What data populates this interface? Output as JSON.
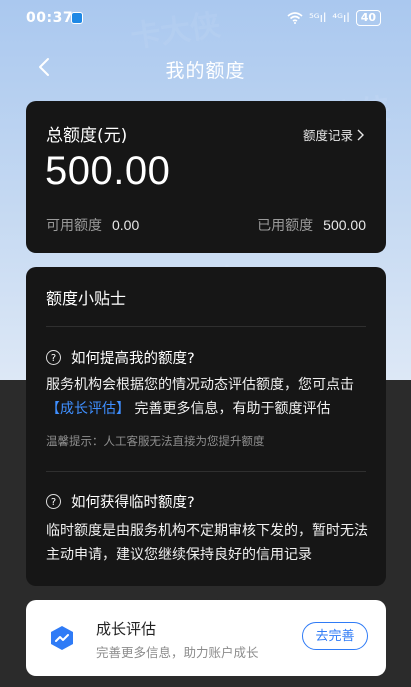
{
  "status_bar": {
    "time": "00:37",
    "signal_1": "⁵ᴳıl",
    "signal_2": "⁴ᴳıl",
    "battery": "40"
  },
  "header": {
    "title": "我的额度"
  },
  "total_card": {
    "label": "总额度(元)",
    "record_link": "额度记录",
    "amount": "500.00",
    "available_label": "可用额度",
    "available_value": "0.00",
    "used_label": "已用额度",
    "used_value": "500.00"
  },
  "tips": {
    "title": "额度小贴士",
    "q1": {
      "question": "如何提高我的额度?",
      "answer_part1": "服务机构会根据您的情况动态评估额度，您可点击",
      "answer_link": "【成长评估】",
      "answer_part2": "完善更多信息，有助于额度评估",
      "hint": "温馨提示：人工客服无法直接为您提升额度"
    },
    "q2": {
      "question": "如何获得临时额度?",
      "answer": "临时额度是由服务机构不定期审核下发的，暂时无法主动申请，建议您继续保持良好的信用记录"
    }
  },
  "growth_card": {
    "title": "成长评估",
    "subtitle": "完善更多信息，助力账户成长",
    "button": "去完善"
  },
  "watermark": {
    "text": "卡大侠",
    "url": "www.kadaxia.com"
  },
  "colors": {
    "accent": "#2f7bf6",
    "link": "#3f8fff",
    "card_bg": "#161616"
  }
}
